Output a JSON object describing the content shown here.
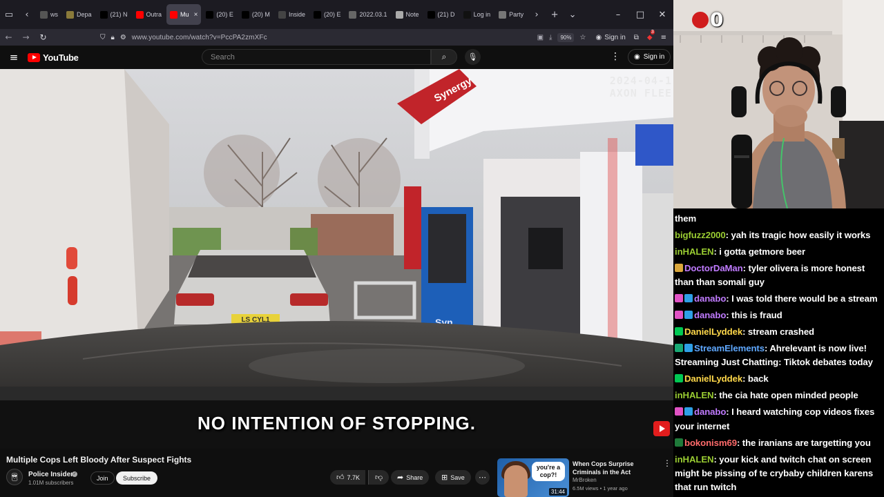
{
  "browser": {
    "tabs": [
      {
        "label": "ws",
        "icon": "news-icon",
        "color": "#555555"
      },
      {
        "label": "Depa",
        "icon": "seal-icon",
        "color": "#8a7a3a"
      },
      {
        "label": "(21) N",
        "icon": "x-icon",
        "color": "#000000"
      },
      {
        "label": "Outra",
        "icon": "youtube-icon",
        "color": "#ff0000"
      },
      {
        "label": "Mu",
        "icon": "youtube-icon",
        "color": "#ff0000",
        "active": true
      },
      {
        "label": "(20) E",
        "icon": "x-icon",
        "color": "#000000"
      },
      {
        "label": "(20) M",
        "icon": "x-icon",
        "color": "#000000"
      },
      {
        "label": "Inside",
        "icon": "news-icon",
        "color": "#444444"
      },
      {
        "label": "(20) E",
        "icon": "x-icon",
        "color": "#000000"
      },
      {
        "label": "2022.03.1",
        "icon": "doc-icon",
        "color": "#666666"
      },
      {
        "label": "Note",
        "icon": "note-icon",
        "color": "#aaaaaa"
      },
      {
        "label": "(21) D",
        "icon": "x-icon",
        "color": "#000000"
      },
      {
        "label": "Log in",
        "icon": "tiktok-icon",
        "color": "#111111"
      },
      {
        "label": "Party",
        "icon": "wiki-icon",
        "color": "#777777"
      }
    ],
    "url": "www.youtube.com/watch?v=PccPA2zmXFc",
    "zoom": "90%",
    "signin_label": "Sign in",
    "ext_badge": "3"
  },
  "youtube": {
    "logo_text": "YouTube",
    "search_placeholder": "Search",
    "signin_label": "Sign in"
  },
  "video": {
    "overlay_date": "2024-04-1",
    "overlay_brand": "AXON FLEE",
    "subtitle": "NO INTENTION OF STOPPING.",
    "sign_text": "Synergy",
    "pump_text": "Syn",
    "plate_text": "LS CYL1"
  },
  "meta": {
    "title": "Multiple Cops Left Bloody After Suspect Fights",
    "channel": "Police Insider",
    "subscribers": "1.01M subscribers",
    "join_label": "Join",
    "subscribe_label": "Subscribe",
    "likes": "7.7K",
    "share_label": "Share",
    "save_label": "Save"
  },
  "recommendation": {
    "title": "When Cops Surprise Criminals in the Act",
    "channel": "MrBroken",
    "meta": "6.5M views • 1 year ago",
    "duration": "31:44",
    "thumb_text": "you're a cop?!"
  },
  "webcam": {
    "counter": "0"
  },
  "chat": [
    {
      "user": "",
      "color": "#ffffff",
      "badges": [],
      "text": "them"
    },
    {
      "user": "bigfuzz2000",
      "color": "#9acd32",
      "badges": [],
      "text": ": yah its tragic how easily it works"
    },
    {
      "user": "inHALEN",
      "color": "#9acd32",
      "badges": [],
      "text": ": i gotta getmore beer"
    },
    {
      "user": "DoctorDaMan",
      "color": "#c07bff",
      "badges": [
        {
          "color": "#d9a63b",
          "icon": "bits-icon"
        }
      ],
      "text": ": tyler olivera is more honest than than somali guy"
    },
    {
      "user": "danabo",
      "color": "#c07bff",
      "badges": [
        {
          "color": "#e052c4",
          "icon": "heart-icon"
        },
        {
          "color": "#2e9fe6",
          "icon": "prime-icon"
        }
      ],
      "text": ": I was told there would be a stream"
    },
    {
      "user": "danabo",
      "color": "#c07bff",
      "badges": [
        {
          "color": "#e052c4",
          "icon": "heart-icon"
        },
        {
          "color": "#2e9fe6",
          "icon": "prime-icon"
        }
      ],
      "text": ": this is fraud"
    },
    {
      "user": "DanielLyddek",
      "color": "#ffd84a",
      "badges": [
        {
          "color": "#00c853",
          "icon": "vip-icon"
        }
      ],
      "text": ": stream crashed"
    },
    {
      "user": "StreamElements",
      "color": "#5fa8ff",
      "badges": [
        {
          "color": "#19a974",
          "icon": "mod-icon"
        },
        {
          "color": "#2e9fe6",
          "icon": "bot-icon"
        }
      ],
      "text": ": Ahrelevant is now live! Streaming Just Chatting: Tiktok debates today"
    },
    {
      "user": "DanielLyddek",
      "color": "#ffd84a",
      "badges": [
        {
          "color": "#00c853",
          "icon": "vip-icon"
        }
      ],
      "text": ": back"
    },
    {
      "user": "inHALEN",
      "color": "#9acd32",
      "badges": [],
      "text": ": the cia hate open minded people"
    },
    {
      "user": "danabo",
      "color": "#c07bff",
      "badges": [
        {
          "color": "#e052c4",
          "icon": "heart-icon"
        },
        {
          "color": "#2e9fe6",
          "icon": "prime-icon"
        }
      ],
      "text": ": I heard watching cop videos fixes your internet"
    },
    {
      "user": "bokonism69",
      "color": "#ff6b6b",
      "badges": [
        {
          "color": "#1f7a3a",
          "icon": "user-icon"
        }
      ],
      "text": ": the iranians are targetting you"
    },
    {
      "user": "inHALEN",
      "color": "#9acd32",
      "badges": [],
      "text": ": your kick and twitch chat on screen might be pissing of te crybaby children karens that run twitch"
    }
  ]
}
